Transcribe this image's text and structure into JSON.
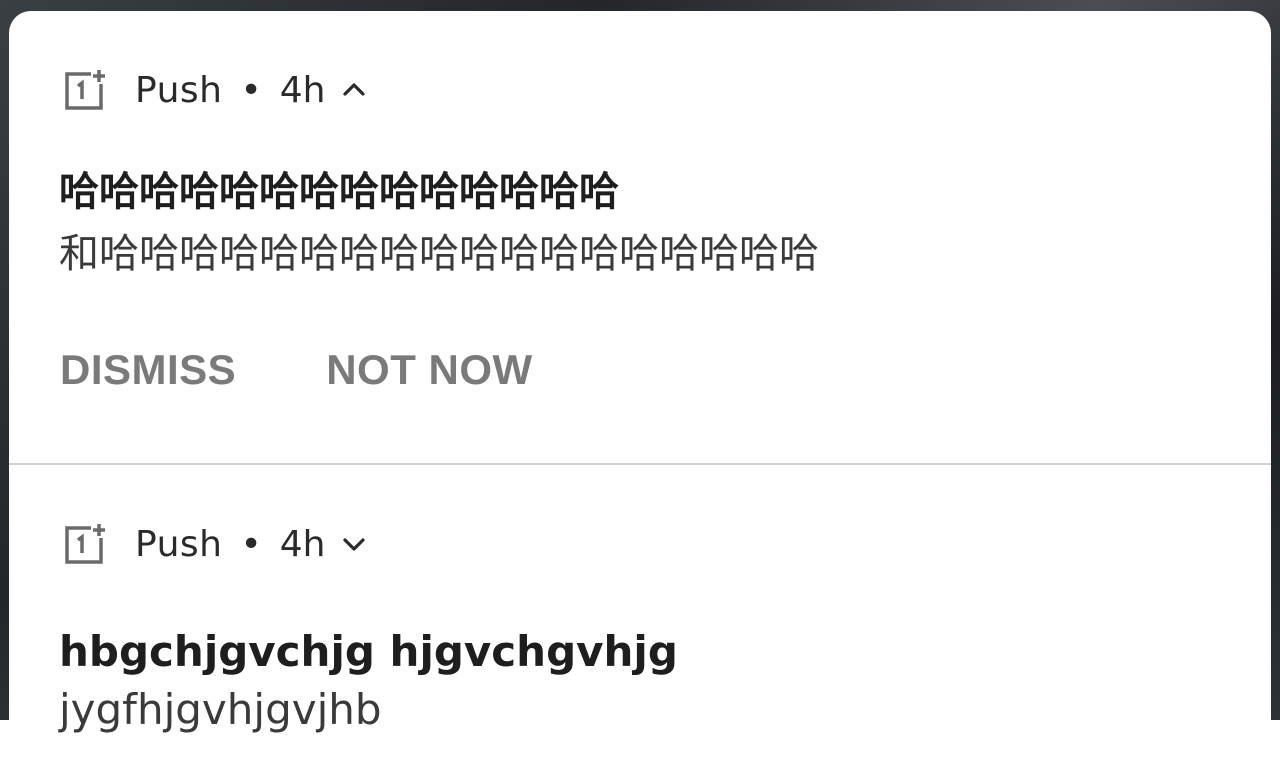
{
  "notifications": [
    {
      "app_icon": "oneplus-logo-icon",
      "app_name": "Push",
      "separator": "•",
      "time": "4h",
      "expand_state": "chevron-up-icon",
      "title": "哈哈哈哈哈哈哈哈哈哈哈哈哈哈",
      "body": "和哈哈哈哈哈哈哈哈哈哈哈哈哈哈哈哈哈哈",
      "actions": [
        "DISMISS",
        "NOT NOW"
      ]
    },
    {
      "app_icon": "oneplus-logo-icon",
      "app_name": "Push",
      "separator": "•",
      "time": "4h",
      "expand_state": "chevron-down-icon",
      "title": "hbgchjgvchjg hjgvchgvhjg",
      "body": "jygfhjgvhjgvjhb"
    }
  ],
  "colors": {
    "panel_bg": "#ffffff",
    "action_text": "#7a7a7a",
    "title_text": "#1e1e1e",
    "divider": "#cfcfcf"
  }
}
